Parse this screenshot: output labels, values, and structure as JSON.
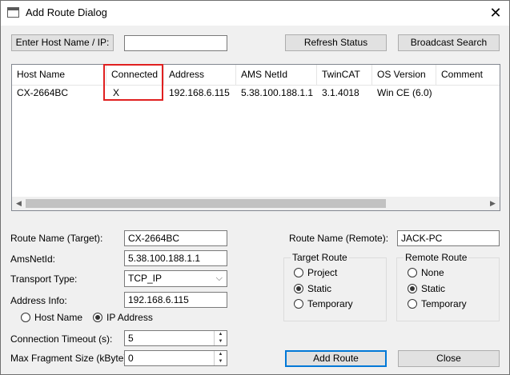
{
  "window": {
    "title": "Add Route Dialog",
    "close_glyph": "✕"
  },
  "toolbar": {
    "enter_host_label": "Enter Host Name / IP:",
    "host_value": "",
    "refresh_label": "Refresh Status",
    "broadcast_label": "Broadcast Search"
  },
  "table": {
    "columns": [
      "Host Name",
      "Connected",
      "Address",
      "AMS NetId",
      "TwinCAT",
      "OS Version",
      "Comment"
    ],
    "rows": [
      [
        "CX-2664BC",
        "X",
        "192.168.6.115",
        "5.38.100.188.1.1",
        "3.1.4018",
        "Win CE (6.0)",
        ""
      ]
    ],
    "scroll_left": "◀",
    "scroll_right": "▶"
  },
  "form": {
    "route_name_target_label": "Route Name (Target):",
    "route_name_target_value": "CX-2664BC",
    "amsnetid_label": "AmsNetId:",
    "amsnetid_value": "5.38.100.188.1.1",
    "transport_label": "Transport Type:",
    "transport_value": "TCP_IP",
    "address_info_label": "Address Info:",
    "address_info_value": "192.168.6.115",
    "host_name_radio": "Host Name",
    "ip_address_radio": "IP Address",
    "conn_timeout_label": "Connection Timeout (s):",
    "conn_timeout_value": "5",
    "max_fragment_label": "Max Fragment Size (kByte):",
    "max_fragment_value": "0",
    "route_name_remote_label": "Route Name (Remote):",
    "route_name_remote_value": "JACK-PC"
  },
  "target_route": {
    "title": "Target Route",
    "options": [
      "Project",
      "Static",
      "Temporary"
    ],
    "selected": "Static"
  },
  "remote_route": {
    "title": "Remote Route",
    "options": [
      "None",
      "Static",
      "Temporary"
    ],
    "selected": "Static"
  },
  "buttons": {
    "add_route": "Add Route",
    "close": "Close"
  },
  "colors": {
    "highlight": "#e02020",
    "default_button_border": "#0078d7"
  }
}
